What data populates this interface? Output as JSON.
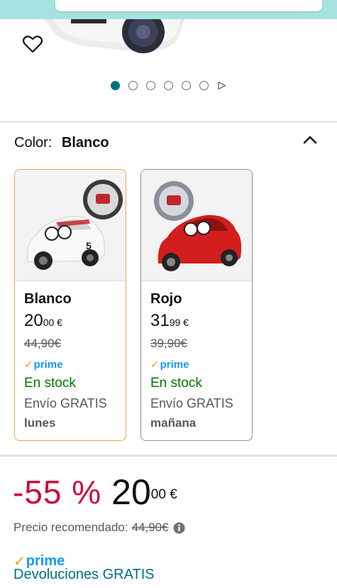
{
  "carousel": {
    "total_images": 6,
    "active_index": 0
  },
  "color_selector": {
    "label": "Color:",
    "selected_value": "Blanco"
  },
  "swatches": [
    {
      "name": "Blanco",
      "price_whole": "20",
      "price_fraction": "00 €",
      "old_price": "44,90€",
      "prime": "prime",
      "stock": "En stock",
      "shipping": "Envío GRATIS",
      "delivery_day": "lunes",
      "selected": true
    },
    {
      "name": "Rojo",
      "price_whole": "31",
      "price_fraction": "99 €",
      "old_price": "39,90€",
      "prime": "prime",
      "stock": "En stock",
      "shipping": "Envío GRATIS",
      "delivery_day": "mañana",
      "selected": false
    }
  ],
  "price_block": {
    "discount": "-55 %",
    "price_whole": "20",
    "price_fraction": "00 €",
    "recommended_label": "Precio recomendado:",
    "recommended_price": "44,90€",
    "prime": "prime",
    "returns": "Devoluciones GRATIS"
  },
  "colors": {
    "accent_teal": "#007185",
    "discount_red": "#cc0c39",
    "stock_green": "#007600",
    "prime_blue": "#1399ff",
    "selected_border": "#e7a847"
  },
  "icons": {
    "favorite": "heart-icon",
    "collapse": "chevron-up-icon",
    "carousel_next": "play-triangle-icon",
    "info": "info-icon"
  }
}
